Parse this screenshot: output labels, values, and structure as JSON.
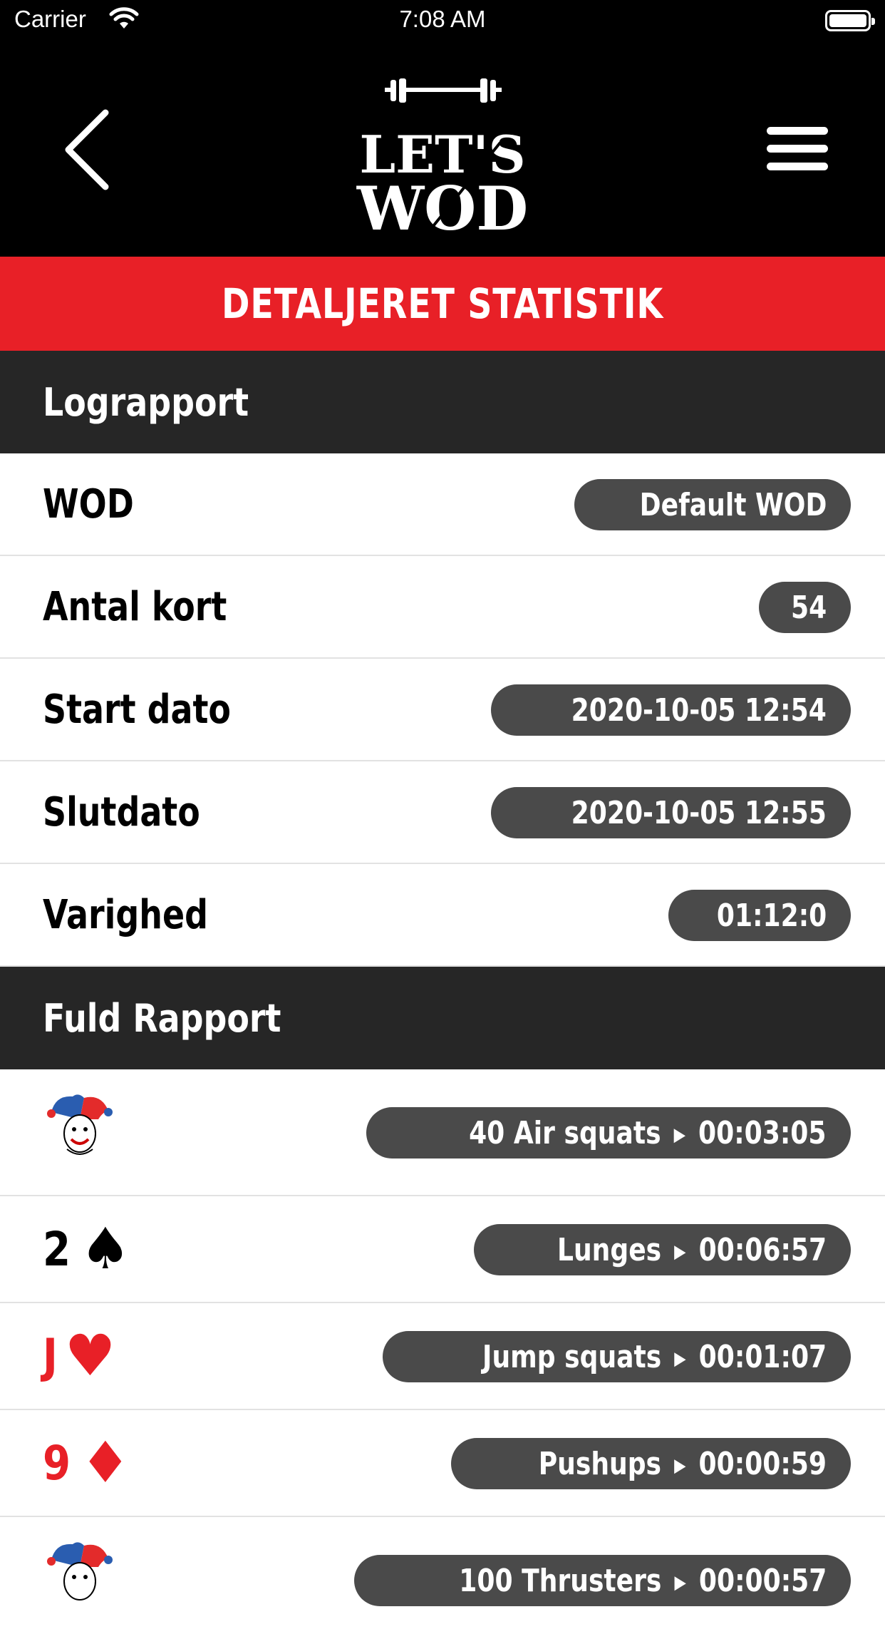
{
  "status_bar": {
    "carrier": "Carrier",
    "time": "7:08 AM"
  },
  "header": {
    "logo_line1": "LET'S",
    "logo_line2": "WOD"
  },
  "page_title": "DETALJERET STATISTIK",
  "log_report": {
    "heading": "Lograpport",
    "rows": [
      {
        "label": "WOD",
        "value": "Default WOD"
      },
      {
        "label": "Antal kort",
        "value": "54"
      },
      {
        "label": "Start dato",
        "value": "2020-10-05 12:54"
      },
      {
        "label": "Slutdato",
        "value": "2020-10-05 12:55"
      },
      {
        "label": "Varighed",
        "value": "01:12:0"
      }
    ]
  },
  "full_report": {
    "heading": "Fuld Rapport",
    "rows": [
      {
        "card": "joker",
        "rank": "",
        "suit": "",
        "exercise": "40 Air squats",
        "time": "00:03:05"
      },
      {
        "card": "2-spades",
        "rank": "2",
        "suit": "♠",
        "color": "#000000",
        "exercise": "Lunges",
        "time": "00:06:57"
      },
      {
        "card": "J-hearts",
        "rank": "J",
        "suit": "♥",
        "color": "#e82027",
        "exercise": "Jump squats",
        "time": "00:01:07"
      },
      {
        "card": "9-diamonds",
        "rank": "9",
        "suit": "♦",
        "color": "#e82027",
        "exercise": "Pushups",
        "time": "00:00:59"
      },
      {
        "card": "joker",
        "rank": "",
        "suit": "",
        "exercise": "100 Thrusters",
        "time": "00:00:57"
      }
    ]
  },
  "colors": {
    "accent": "#e82027",
    "header_bg": "#000000",
    "section_bg": "#262626",
    "pill_bg": "#4a4a4a"
  }
}
